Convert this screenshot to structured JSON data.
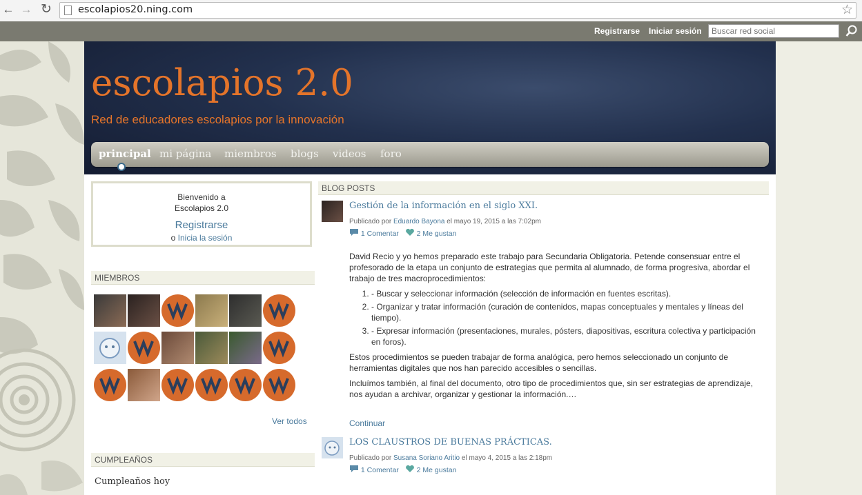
{
  "browser": {
    "url": "escolapios20.ning.com"
  },
  "topbar": {
    "signup": "Registrarse",
    "login": "Iniciar sesión",
    "search_placeholder": "Buscar red social"
  },
  "site": {
    "title": "escolapios 2.0",
    "tagline": "Red de educadores escolapios por la innovación",
    "nav": [
      "principal",
      "mi página",
      "miembros",
      "blogs",
      "videos",
      "foro"
    ],
    "accent_color": "#e4742a"
  },
  "welcome": {
    "line1": "Bienvenido a",
    "line2": "Escolapios 2.0",
    "signup": "Registrarse",
    "or": "o",
    "login": "Inicia la sesión"
  },
  "members": {
    "header": "MIEMBROS",
    "see_all": "Ver todos"
  },
  "birthdays": {
    "header": "CUMPLEAÑOS",
    "today": "Cumpleaños hoy"
  },
  "blog": {
    "header": "BLOG POSTS",
    "posts": [
      {
        "title": "Gestión de la información en el siglo XXI.",
        "published_by": "Publicado por",
        "author": "Eduardo Bayona",
        "date": "el mayo 19, 2015 a las 7:02pm",
        "comments": "1 Comentar",
        "likes": "2 Me gustan",
        "intro": "David Recio y yo hemos preparado este trabajo para Secundaria Obligatoria. Petende consensuar entre el profesorado de la etapa un conjunto de estrategias que permita al alumnado, de forma progresiva, abordar el trabajo de tres macroprocedimientos:",
        "list": [
          "- Buscar y seleccionar información (selección de información en fuentes escritas).",
          "- Organizar y tratar información (curación de contenidos, mapas conceptuales y mentales y líneas del tiempo).",
          "- Expresar información (presentaciones, murales, pósters, diapositivas, escritura colectiva y participación en foros)."
        ],
        "para2": "Estos procedimientos se pueden trabajar de forma analógica, pero hemos seleccionado un conjunto de herramientas digitales que nos han parecido accesibles o sencillas.",
        "para3": "Incluímos también, al final del documento, otro tipo de procedimientos que, sin ser estrategias de aprendizaje, nos ayudan a archivar, organizar y gestionar la información.…",
        "continue": "Continuar"
      },
      {
        "title": "LOS CLAUSTROS DE BUENAS PRÁCTICAS.",
        "published_by": "Publicado por",
        "author": "Susana Soriano Aritio",
        "date": "el mayo 4, 2015 a las 2:18pm",
        "comments": "1 Comentar",
        "likes": "2 Me gustan"
      }
    ]
  }
}
